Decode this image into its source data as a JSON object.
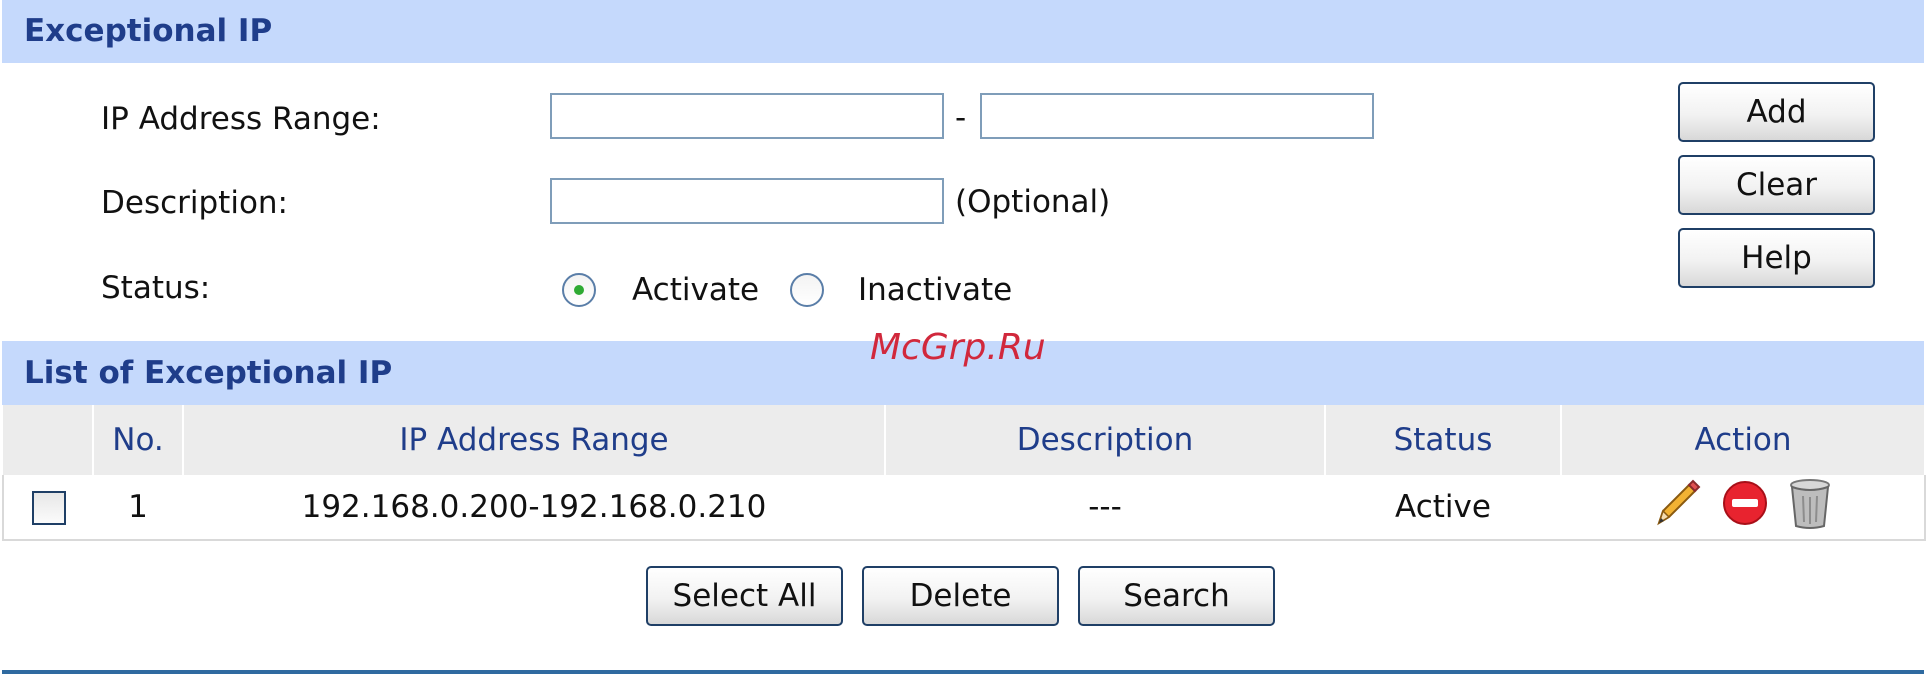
{
  "exceptional_ip": {
    "title": "Exceptional IP",
    "ip_range_label": "IP Address Range:",
    "ip_range_start": "",
    "ip_range_separator": "-",
    "ip_range_end": "",
    "description_label": "Description:",
    "description_value": "",
    "optional_note": "(Optional)",
    "status_label": "Status:",
    "status_options": [
      "Activate",
      "Inactivate"
    ],
    "status_selected": "Activate",
    "buttons": {
      "add": "Add",
      "clear": "Clear",
      "help": "Help"
    }
  },
  "watermark": "McGrp.Ru",
  "list": {
    "title": "List of Exceptional IP",
    "columns": [
      "",
      "No.",
      "IP Address Range",
      "Description",
      "Status",
      "Action"
    ],
    "rows": [
      {
        "checked": false,
        "no": "1",
        "ip_range": "192.168.0.200-192.168.0.210",
        "description": "---",
        "status": "Active",
        "actions": [
          "edit-icon",
          "disable-icon",
          "delete-icon"
        ]
      }
    ],
    "buttons": {
      "select_all": "Select All",
      "delete": "Delete",
      "search": "Search"
    }
  },
  "colors": {
    "header_bg": "#c5d9fc",
    "header_text": "#1f3d8a",
    "watermark": "#d1283c",
    "rule": "#2f6aa0"
  }
}
